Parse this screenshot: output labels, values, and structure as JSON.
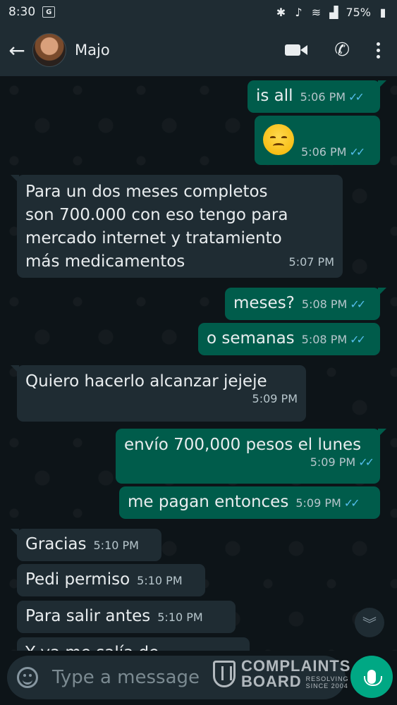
{
  "status_bar": {
    "time": "8:30",
    "notif_icon": "G",
    "battery": "75%"
  },
  "header": {
    "contact_name": "Majo"
  },
  "messages": [
    {
      "dir": "out",
      "text": "is all",
      "time": "5:06 PM"
    },
    {
      "dir": "out",
      "emoji": "disappointed-face",
      "time": "5:06 PM"
    },
    {
      "dir": "in",
      "lines": [
        "Para un dos meses completos",
        "son 700.000 con eso tengo para",
        "mercado internet y tratamiento",
        "más medicamentos"
      ],
      "time": "5:07 PM"
    },
    {
      "dir": "out",
      "text": "meses?",
      "time": "5:08 PM"
    },
    {
      "dir": "out",
      "text": "o semanas",
      "time": "5:08 PM"
    },
    {
      "dir": "in",
      "text": "Quiero hacerlo alcanzar jejeje",
      "time": "5:09 PM"
    },
    {
      "dir": "out",
      "text": "envío 700,000 pesos el lunes",
      "time": "5:09 PM"
    },
    {
      "dir": "out",
      "text": "me pagan entonces",
      "time": "5:09 PM"
    },
    {
      "dir": "in",
      "text": "Gracias",
      "time": "5:10 PM"
    },
    {
      "dir": "in",
      "text": "Pedi permiso",
      "time": "5:10 PM"
    },
    {
      "dir": "in",
      "text": "Para salir antes",
      "time": "5:10 PM"
    },
    {
      "dir": "in",
      "text": "Y ya   me salía de",
      "time": ""
    }
  ],
  "input": {
    "placeholder": "Type a message"
  },
  "watermark": {
    "line1": "COMPLAINTS",
    "line2": "BOARD",
    "tag1": "RESOLVING",
    "tag2": "SINCE 2004"
  },
  "colors": {
    "outgoing_bubble": "#005c4b",
    "incoming_bubble": "#1f2c33",
    "read_ticks": "#53bdeb",
    "mic_button": "#00a884"
  }
}
